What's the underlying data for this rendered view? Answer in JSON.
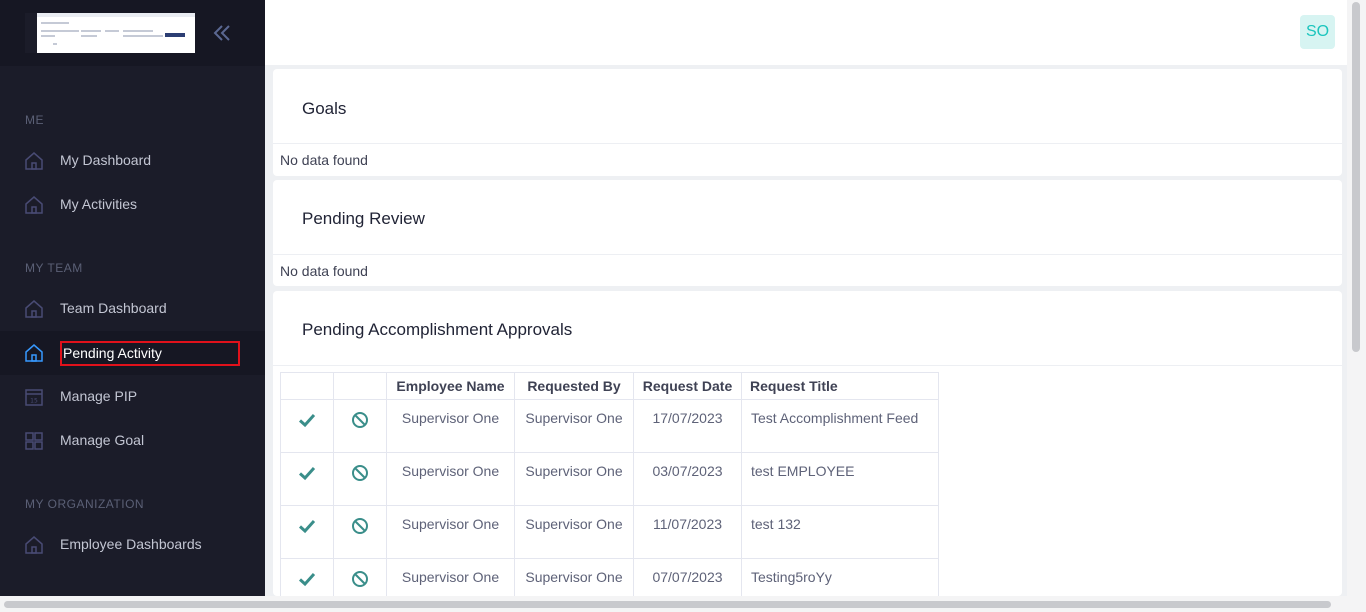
{
  "sidebar": {
    "sections": {
      "me": "ME",
      "my_team": "MY TEAM",
      "my_org": "MY ORGANIZATION"
    },
    "items": [
      {
        "label": "My Dashboard",
        "icon": "home-icon"
      },
      {
        "label": "My Activities",
        "icon": "home-icon"
      },
      {
        "label": "Team Dashboard",
        "icon": "home-icon"
      },
      {
        "label": "Pending Activity",
        "icon": "home-icon",
        "active": true
      },
      {
        "label": "Manage PIP",
        "icon": "calendar-icon"
      },
      {
        "label": "Manage Goal",
        "icon": "grid-icon"
      },
      {
        "label": "Employee Dashboards",
        "icon": "home-icon"
      }
    ]
  },
  "header": {
    "avatar_initials": "SO"
  },
  "goals": {
    "title": "Goals",
    "empty": "No data found"
  },
  "pending_review": {
    "title": "Pending Review",
    "empty": "No data found"
  },
  "approvals": {
    "title": "Pending Accomplishment Approvals",
    "columns": [
      "Employee Name",
      "Requested By",
      "Request Date",
      "Request Title"
    ],
    "rows": [
      {
        "employee": "Supervisor One",
        "requested_by": "Supervisor One",
        "date": "17/07/2023",
        "title": "Test Accomplishment Feed"
      },
      {
        "employee": "Supervisor One",
        "requested_by": "Supervisor One",
        "date": "03/07/2023",
        "title": "test EMPLOYEE"
      },
      {
        "employee": "Supervisor One",
        "requested_by": "Supervisor One",
        "date": "11/07/2023",
        "title": "test 132"
      },
      {
        "employee": "Supervisor One",
        "requested_by": "Supervisor One",
        "date": "07/07/2023",
        "title": "Testing5roYy"
      }
    ]
  },
  "colors": {
    "sidebar_bg": "#1b1c29",
    "accent": "#1bc5bd",
    "approve_icon": "#3a8e8a",
    "active_outline": "#e0111b"
  }
}
